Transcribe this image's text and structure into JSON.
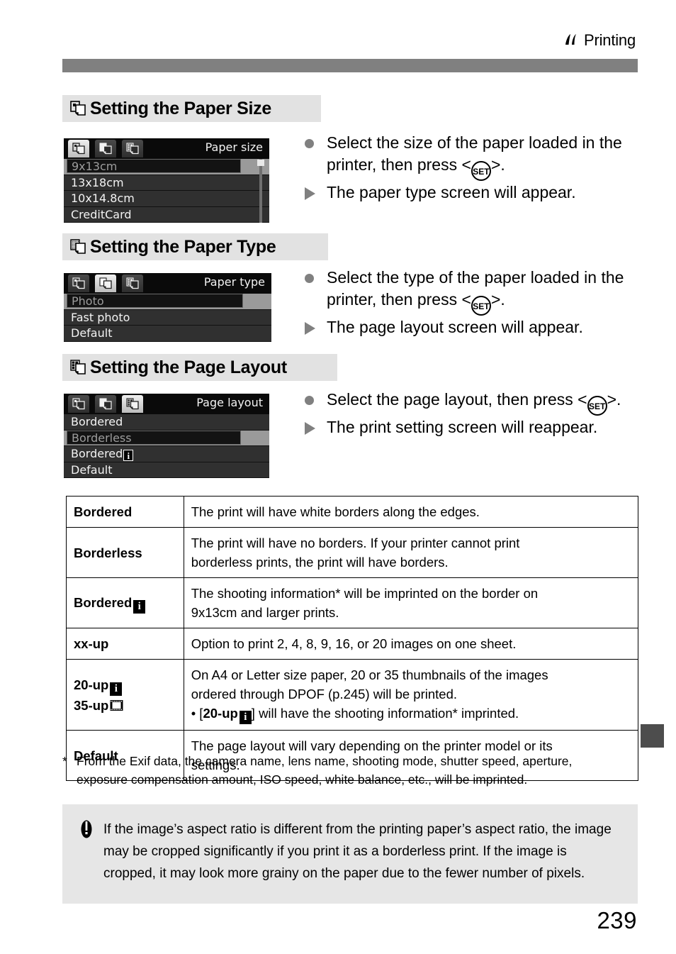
{
  "header": {
    "label": "Printing",
    "icon": "printer-flag-icon"
  },
  "sections": [
    {
      "id": "paper-size",
      "heading": "Setting the Paper Size",
      "heading_icon": "paper-size-icon",
      "lcd": {
        "title": "Paper size",
        "active_tab": 0,
        "tabs": [
          "paper-size-tab-icon",
          "paper-type-tab-icon",
          "page-layout-tab-icon"
        ],
        "items": [
          "9x13cm",
          "13x18cm",
          "10x14.8cm",
          "CreditCard"
        ],
        "selected_index": 0,
        "has_scrollbar": true
      },
      "instructions": [
        {
          "marker": "dot",
          "text": "Select the size of the paper loaded in the printer, then press <",
          "key": "SET",
          "text_after": ">."
        },
        {
          "marker": "triangle",
          "text": "The paper type screen will appear."
        }
      ]
    },
    {
      "id": "paper-type",
      "heading": "Setting the Paper Type",
      "heading_icon": "paper-type-icon",
      "lcd": {
        "title": "Paper type",
        "active_tab": 1,
        "tabs": [
          "paper-size-tab-icon",
          "paper-type-tab-icon",
          "page-layout-tab-icon"
        ],
        "items": [
          "Photo",
          "Fast photo",
          "Default"
        ],
        "selected_index": 0,
        "has_scrollbar": false
      },
      "instructions": [
        {
          "marker": "dot",
          "text": "Select the type of the paper loaded in the printer, then press <",
          "key": "SET",
          "text_after": ">."
        },
        {
          "marker": "triangle",
          "text": "The page layout screen will appear."
        }
      ]
    },
    {
      "id": "page-layout",
      "heading": "Setting the Page Layout",
      "heading_icon": "page-layout-icon",
      "lcd": {
        "title": "Page layout",
        "active_tab": 2,
        "tabs": [
          "paper-size-tab-icon",
          "paper-type-tab-icon",
          "page-layout-tab-icon"
        ],
        "items": [
          "Bordered",
          "Borderless",
          "Bordered",
          "Default"
        ],
        "item_badges": [
          null,
          null,
          "i",
          null
        ],
        "selected_index": 1,
        "has_scrollbar": false
      },
      "instructions": [
        {
          "marker": "dot",
          "text": "Select the page layout, then press <",
          "key": "SET",
          "text_after": ">."
        },
        {
          "marker": "triangle",
          "text": "The print setting screen will reappear."
        }
      ]
    }
  ],
  "table": {
    "rows": [
      {
        "term": "Bordered",
        "term_badge": null,
        "term_line2": null,
        "desc": "The print will have white borders along the edges.",
        "desc_line2": null,
        "desc_bullet": null
      },
      {
        "term": "Borderless",
        "term_badge": null,
        "term_line2": null,
        "desc": "The print will have no borders. If your printer cannot print",
        "desc_line2": "borderless prints, the print will have borders.",
        "desc_bullet": null
      },
      {
        "term": "Bordered",
        "term_badge": "i",
        "term_line2": null,
        "desc": "The shooting information* will be imprinted on the border on",
        "desc_line2": "9x13cm and larger prints.",
        "desc_bullet": null
      },
      {
        "term": "xx-up",
        "term_badge": null,
        "term_line2": null,
        "desc": "Option to print 2, 4, 8, 9, 16, or 20 images on one sheet.",
        "desc_line2": null,
        "desc_bullet": null
      },
      {
        "term": "20-up",
        "term_badge": "i",
        "term_line2": "35-up",
        "term_line2_badge": "film",
        "desc": "On A4 or Letter size paper, 20 or 35 thumbnails of the images",
        "desc_line2": "ordered through DPOF (p.245) will be printed.",
        "desc_bullet_pre": "• [",
        "desc_bullet_strong": "20-up",
        "desc_bullet_badge": "i",
        "desc_bullet_post": "] will have the shooting information* imprinted."
      },
      {
        "term": "Default",
        "term_badge": null,
        "term_line2": null,
        "desc": "The page layout will vary depending on the printer model or its",
        "desc_line2": "settings.",
        "desc_bullet": null
      }
    ]
  },
  "footnote": {
    "mark": "*",
    "line1": "From the Exif data, the camera name, lens name, shooting mode, shutter speed, aperture,",
    "line2": "exposure compensation amount, ISO speed, white balance, etc., will be imprinted."
  },
  "caution": {
    "icon": "caution-icon",
    "text": "If the image’s aspect ratio is different from the printing paper’s aspect ratio, the image may be cropped significantly if you print it as a borderless print. If the image is cropped, it may look more grainy on the paper due to the fewer number of pixels."
  },
  "page_number": "239"
}
